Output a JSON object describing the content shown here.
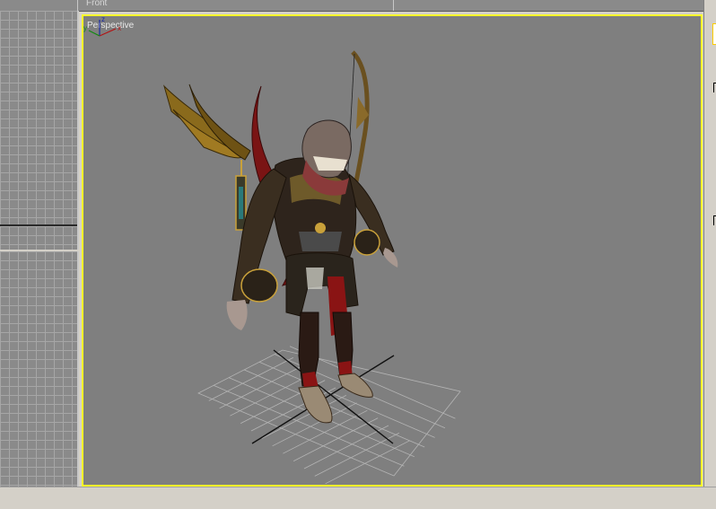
{
  "viewports": {
    "front_label": "Front",
    "perspective_label": "Perspective"
  },
  "axis_gizmo": {
    "x": "x",
    "y": "y",
    "z": "z"
  },
  "colors": {
    "active_viewport_border": "#ffff2a",
    "viewport_bg": "#7f7f7f",
    "grid_lines": "#a6a6a6"
  },
  "icons": [
    "axis-tripod-icon",
    "character-model"
  ]
}
